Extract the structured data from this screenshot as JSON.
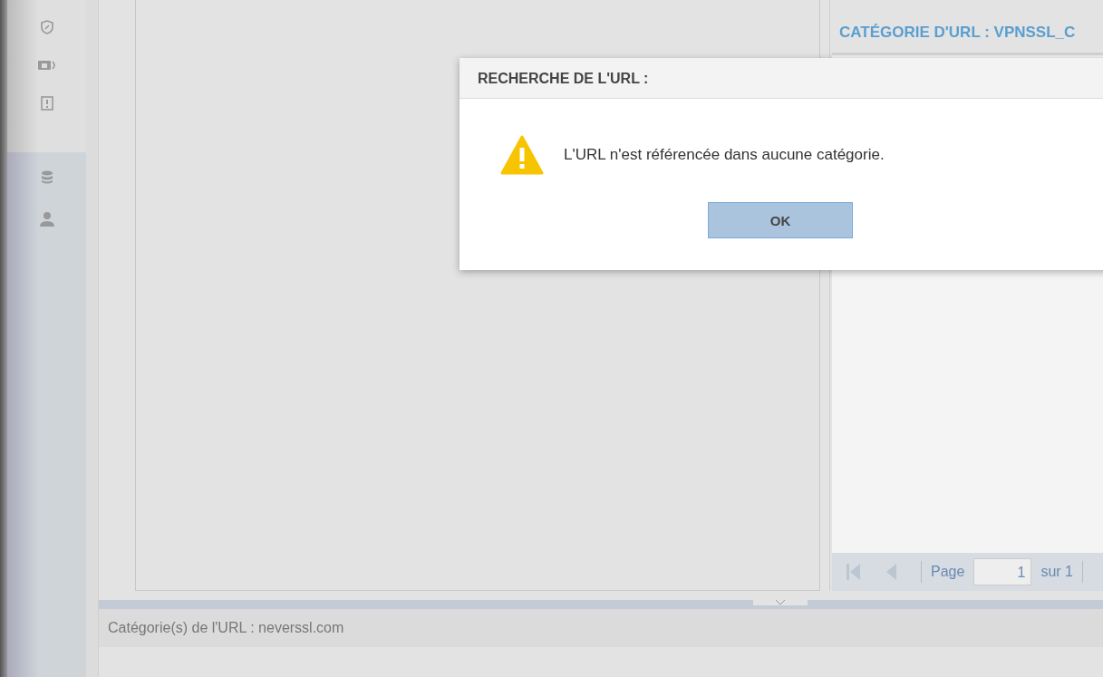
{
  "sidebar": {
    "top_items": [
      {
        "kind": "shield"
      },
      {
        "kind": "card"
      },
      {
        "kind": "alert"
      }
    ],
    "bottom_items": [
      {
        "kind": "database"
      },
      {
        "kind": "user"
      }
    ]
  },
  "right_panel": {
    "title": "CATÉGORIE D'URL : VPNSSL_C",
    "pager": {
      "page_label": "Page",
      "page_value": "1",
      "total": "sur 1"
    }
  },
  "status_bar": {
    "text": "Catégorie(s) de l'URL : neverssl.com"
  },
  "dialog": {
    "title": "RECHERCHE DE L'URL :",
    "message": "L'URL n'est référencée dans aucune catégorie.",
    "buttons": [
      "OK"
    ]
  }
}
